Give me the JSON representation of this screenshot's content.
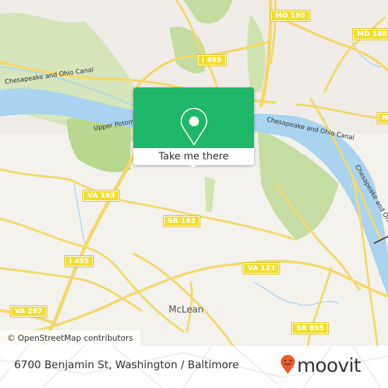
{
  "map": {
    "popup": {
      "button_label": "Take me there",
      "icon": "location-pin-icon",
      "color": "#1fb86a"
    },
    "road_shields": [
      {
        "id": "md190",
        "label": "MD 190"
      },
      {
        "id": "md188",
        "label": "MD 188"
      },
      {
        "id": "i495_top",
        "label": "I 495"
      },
      {
        "id": "md_right",
        "label": "M"
      },
      {
        "id": "va193",
        "label": "VA 193"
      },
      {
        "id": "sr193",
        "label": "SR 193"
      },
      {
        "id": "i495_left",
        "label": "I 495"
      },
      {
        "id": "va123",
        "label": "VA 123"
      },
      {
        "id": "va267",
        "label": "VA 267"
      },
      {
        "id": "sr695",
        "label": "SR 695"
      }
    ],
    "places": [
      {
        "id": "mclean",
        "label": "McLean"
      }
    ],
    "water_labels": [
      {
        "id": "canal_left",
        "label": "Chesapeake and Ohio Canal"
      },
      {
        "id": "upper_potomac",
        "label": "Upper Potomac"
      },
      {
        "id": "canal_center",
        "label": "Chesapeake and Ohio Canal"
      },
      {
        "id": "canal_right",
        "label": "Chesapeake and Ohio"
      }
    ],
    "attribution": "© OpenStreetMap contributors"
  },
  "footer": {
    "address": "6700 Benjamin St, Washington / Baltimore",
    "brand": "moovit",
    "brand_icon": "moovit-pin-icon",
    "brand_color": "#f05a28"
  }
}
